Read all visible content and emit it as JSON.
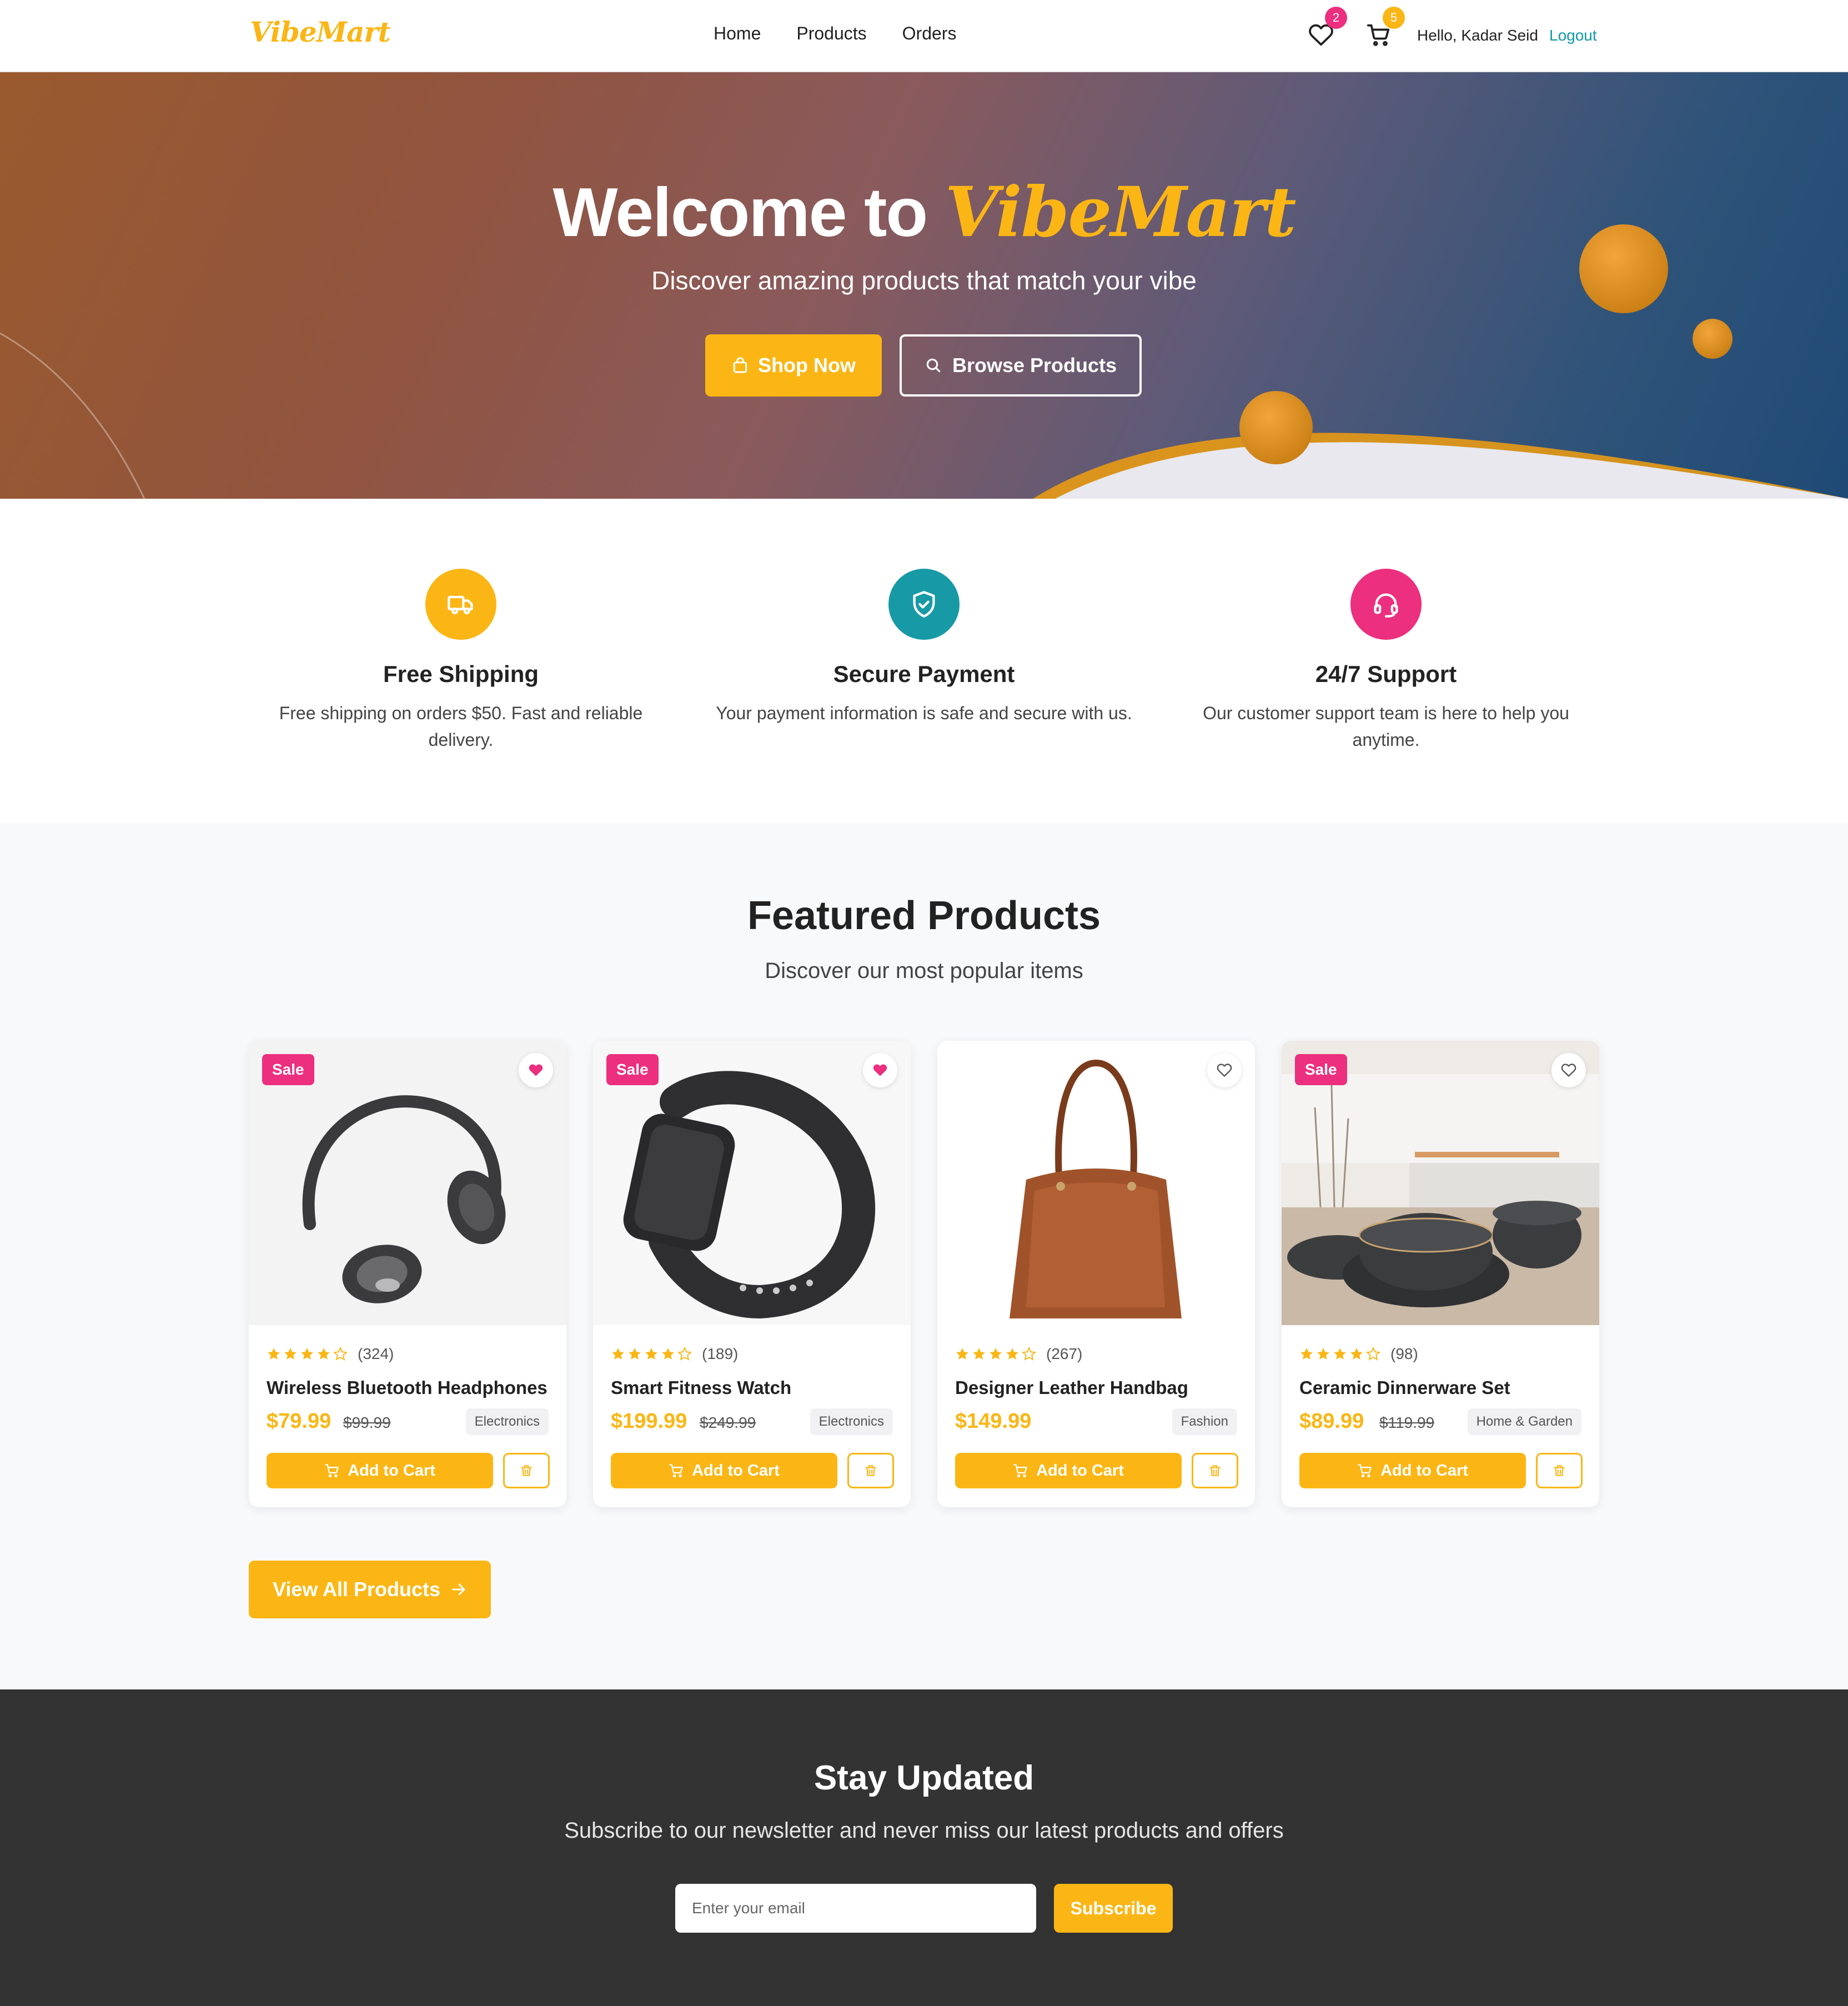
{
  "header": {
    "logo": "VibeMart",
    "nav": [
      "Home",
      "Products",
      "Orders"
    ],
    "wishlist_count": "2",
    "cart_count": "5",
    "greeting": "Hello, Kadar Seid",
    "logout": "Logout"
  },
  "hero": {
    "title_prefix": "Welcome to",
    "title_brand": "VibeMart",
    "subtitle": "Discover amazing products that match your vibe",
    "shop_now": "Shop Now",
    "browse_products": "Browse Products"
  },
  "features": [
    {
      "title": "Free Shipping",
      "desc": "Free shipping on orders $50. Fast and reliable delivery.",
      "icon": "truck-icon",
      "color": "#fbb615"
    },
    {
      "title": "Secure Payment",
      "desc": "Your payment information is safe and secure with us.",
      "icon": "shield-icon",
      "color": "#179aa6"
    },
    {
      "title": "24/7 Support",
      "desc": "Our customer support team is here to help you anytime.",
      "icon": "headset-icon",
      "color": "#ec2f7e"
    }
  ],
  "featured": {
    "title": "Featured Products",
    "subtitle": "Discover our most popular items",
    "products": [
      {
        "name": "Wireless Bluetooth Headphones",
        "rating": 4.5,
        "reviews": "(324)",
        "price": "$79.99",
        "old_price": "$99.99",
        "category": "Electronics",
        "sale": "Sale",
        "wishlisted": true
      },
      {
        "name": "Smart Fitness Watch",
        "rating": 4.5,
        "reviews": "(189)",
        "price": "$199.99",
        "old_price": "$249.99",
        "category": "Electronics",
        "sale": "Sale",
        "wishlisted": true
      },
      {
        "name": "Designer Leather Handbag",
        "rating": 4.5,
        "reviews": "(267)",
        "price": "$149.99",
        "old_price": "",
        "category": "Fashion",
        "sale": "",
        "wishlisted": false
      },
      {
        "name": "Ceramic Dinnerware Set",
        "rating": 4.5,
        "reviews": "(98)",
        "price": "$89.99",
        "old_price": "$119.99",
        "category": "Home & Garden",
        "sale": "Sale",
        "wishlisted": false
      }
    ],
    "add_to_cart": "Add to Cart",
    "view_all": "View All Products"
  },
  "newsletter": {
    "title": "Stay Updated",
    "subtitle": "Subscribe to our newsletter and never miss our latest products and offers",
    "placeholder": "Enter your email",
    "button": "Subscribe"
  },
  "colors": {
    "accent": "#fbb615",
    "teal": "#179aa6",
    "pink": "#ec2f7e",
    "dark": "#333333"
  }
}
